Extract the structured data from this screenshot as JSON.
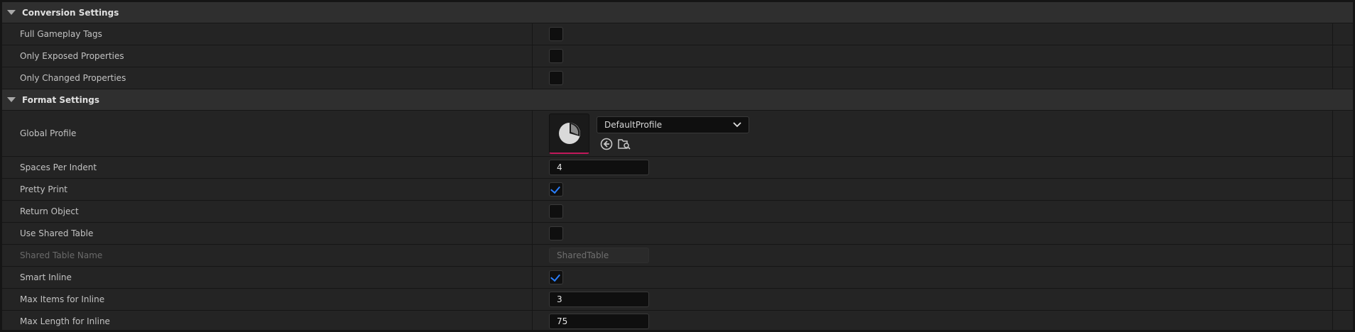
{
  "sections": {
    "conversion": {
      "title": "Conversion Settings",
      "full_gameplay_tags": {
        "label": "Full Gameplay Tags",
        "checked": false
      },
      "only_exposed_properties": {
        "label": "Only Exposed Properties",
        "checked": false
      },
      "only_changed_properties": {
        "label": "Only Changed Properties",
        "checked": false
      }
    },
    "format": {
      "title": "Format Settings",
      "global_profile": {
        "label": "Global Profile",
        "value": "DefaultProfile",
        "icons": [
          "browse-to-asset-icon",
          "find-in-content-browser-icon"
        ]
      },
      "spaces_per_indent": {
        "label": "Spaces Per Indent",
        "value": "4"
      },
      "pretty_print": {
        "label": "Pretty Print",
        "checked": true
      },
      "return_object": {
        "label": "Return Object",
        "checked": false
      },
      "use_shared_table": {
        "label": "Use Shared Table",
        "checked": false
      },
      "shared_table_name": {
        "label": "Shared Table Name",
        "value": "SharedTable",
        "disabled": true
      },
      "smart_inline": {
        "label": "Smart Inline",
        "checked": true
      },
      "max_items_for_inline": {
        "label": "Max Items for Inline",
        "value": "3"
      },
      "max_length_for_inline": {
        "label": "Max Length for Inline",
        "value": "75"
      }
    }
  },
  "colors": {
    "accent": "#2a7fff",
    "thumbnail_underline": "#c2185b"
  }
}
